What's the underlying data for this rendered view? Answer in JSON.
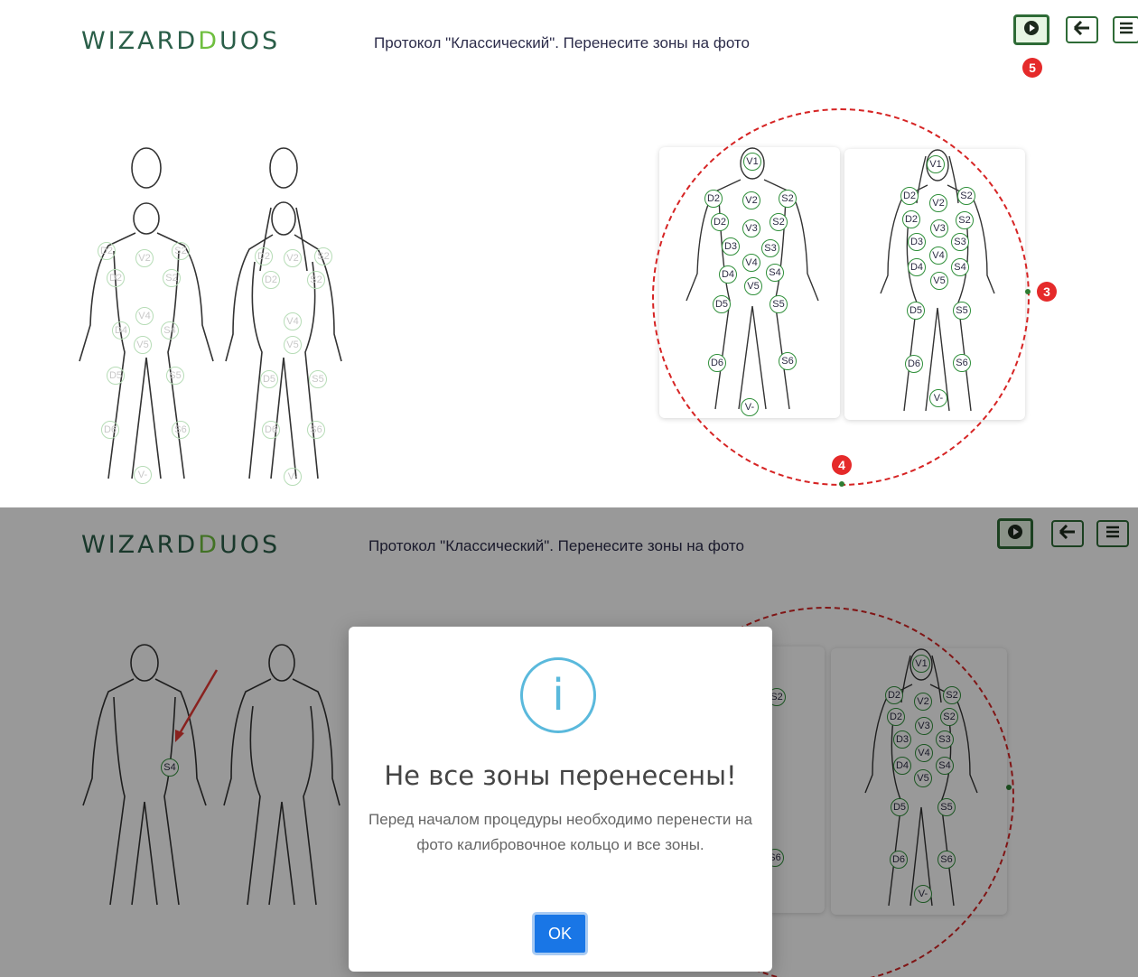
{
  "header": {
    "logo_part1": "WIZARD",
    "logo_part2": "D",
    "logo_part3": "UOS",
    "protocol_title": "Протокол \"Классический\". Перенесите зоны на фото"
  },
  "toolbar": {
    "play_icon": "play-icon",
    "back_icon": "arrow-left-icon",
    "menu_icon": "menu-icon"
  },
  "annotations": {
    "badge_play": "5",
    "badge_ring_right": "3",
    "badge_ring_bottom": "4"
  },
  "zones": {
    "male": [
      "V1",
      "D2",
      "V2",
      "S2",
      "D2",
      "V3",
      "S2",
      "D3",
      "S3",
      "D4",
      "V4",
      "S4",
      "D5",
      "V5",
      "S5",
      "D6",
      "S6",
      "V-"
    ],
    "female": [
      "V1",
      "D2",
      "V2",
      "S2",
      "D2",
      "V3",
      "S2",
      "D3",
      "S3",
      "D4",
      "V4",
      "S4",
      "V5",
      "D5",
      "S5",
      "D6",
      "S6",
      "V-"
    ],
    "left_faint_male": [
      "D2",
      "V2",
      "S2",
      "D2",
      "S2",
      "V4",
      "D4",
      "S4",
      "V5",
      "D5",
      "S5",
      "D6",
      "S6",
      "V-"
    ],
    "left_faint_female": [
      "D2",
      "V2",
      "S2",
      "D2",
      "S2",
      "V4",
      "V5",
      "D5",
      "S5",
      "D6",
      "S6",
      "V-"
    ],
    "placed": "S4"
  },
  "modal": {
    "icon": "info-icon",
    "title": "Не все зоны перенесены!",
    "message": "Перед началом процедуры необходимо перенести на фото калибровочное кольцо и все зоны.",
    "ok_label": "OK"
  },
  "colors": {
    "brand_dark": "#2a5e48",
    "brand_green": "#6fbf3f",
    "zone_border": "#2f8f3a",
    "ring": "#d62424",
    "badge": "#e52a2a",
    "info": "#5ab9dc",
    "ok_button": "#1976e6"
  }
}
